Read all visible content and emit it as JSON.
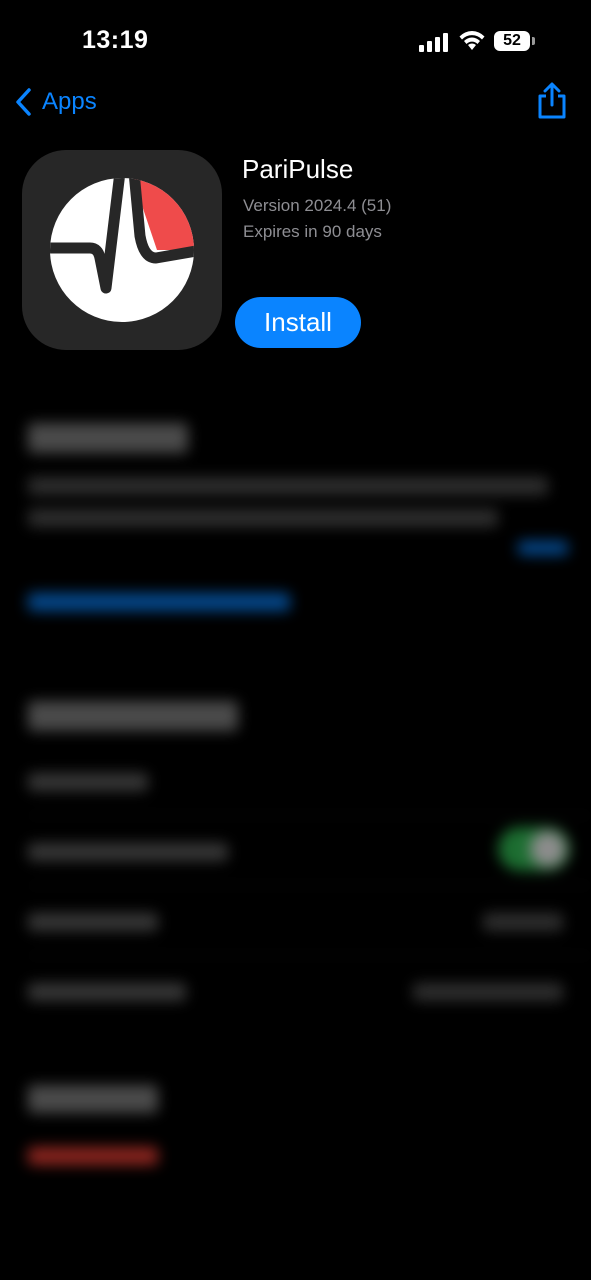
{
  "status_bar": {
    "time": "13:19",
    "battery": "52"
  },
  "nav": {
    "back_label": "Apps"
  },
  "app": {
    "name": "PariPulse",
    "version": "Version 2024.4 (51)",
    "expiry": "Expires in 90 days",
    "install_label": "Install"
  },
  "colors": {
    "accent": "#0a84ff",
    "icon_red": "#ef4b4b",
    "toggle_green": "#34c759"
  }
}
